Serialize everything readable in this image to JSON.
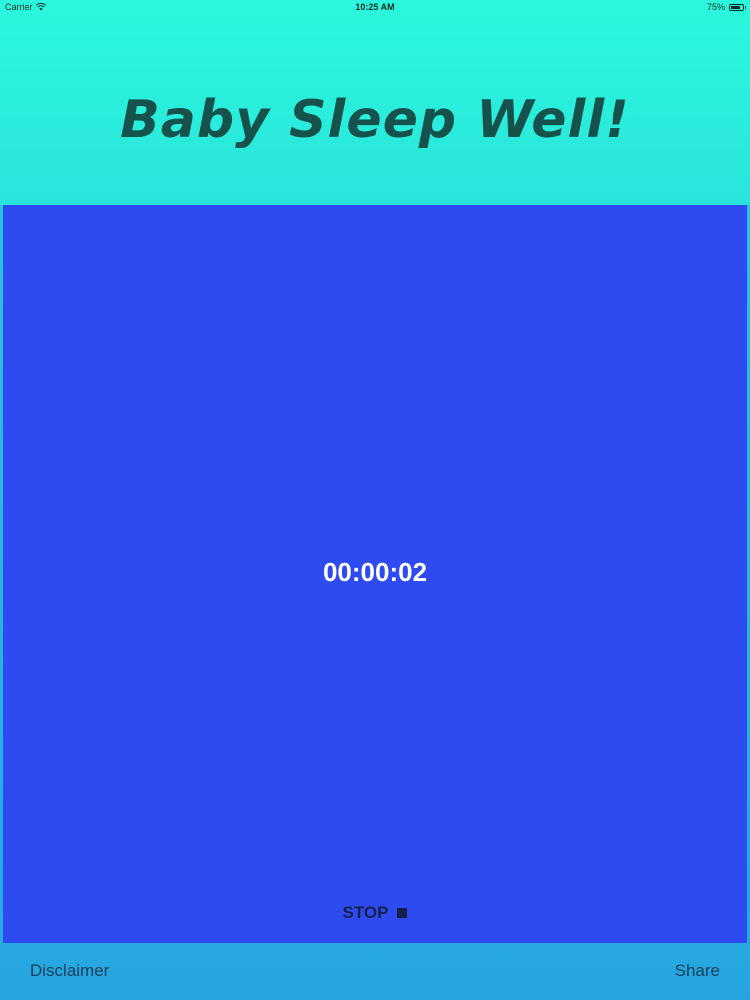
{
  "status_bar": {
    "carrier": "Carrier",
    "time": "10:25 AM",
    "battery": "75%",
    "wifi_icon": "wifi-icon",
    "battery_icon": "battery-icon"
  },
  "header": {
    "title": "Baby Sleep Well!"
  },
  "player": {
    "timer": "00:00:02",
    "stop_label": "STOP",
    "stop_icon": "stop-icon"
  },
  "toolbar": {
    "disclaimer_label": "Disclaimer",
    "share_label": "Share"
  },
  "colors": {
    "header_bg": "#2bf8dc",
    "title": "#15524b",
    "panel_bg": "#2e4bf2",
    "toolbar_bg": "#27a9df"
  }
}
